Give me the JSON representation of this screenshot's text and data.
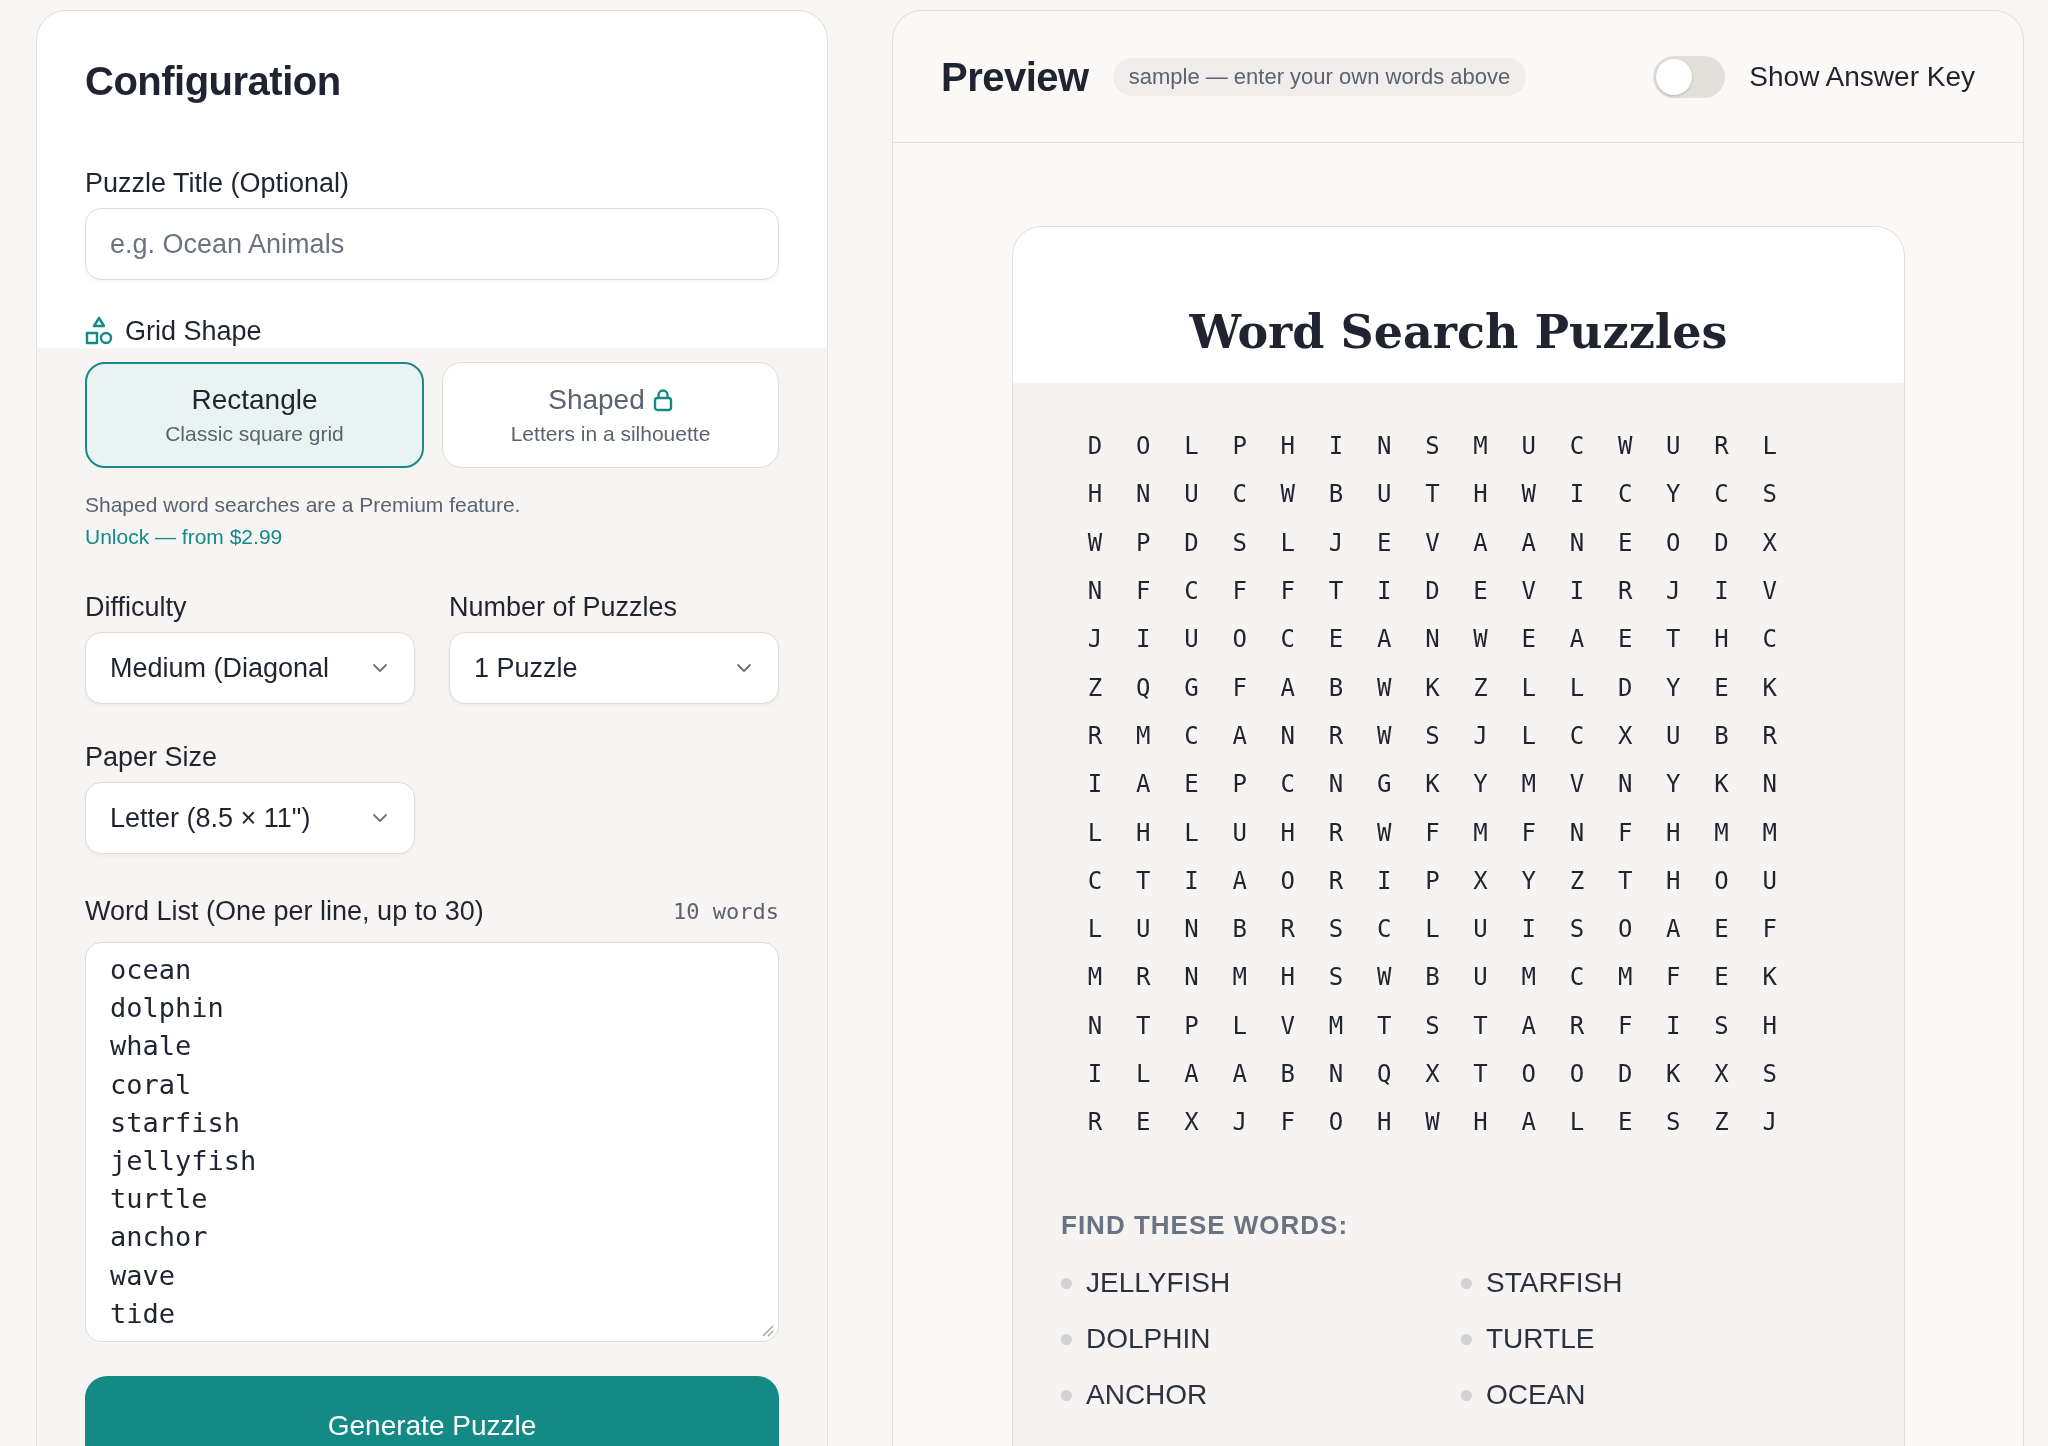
{
  "config": {
    "heading": "Configuration",
    "title_field": {
      "label": "Puzzle Title (Optional)",
      "placeholder": "e.g. Ocean Animals"
    },
    "grid_shape": {
      "label": "Grid Shape",
      "options": [
        {
          "title": "Rectangle",
          "subtitle": "Classic square grid",
          "selected": true,
          "locked": false
        },
        {
          "title": "Shaped",
          "subtitle": "Letters in a silhouette",
          "selected": false,
          "locked": true
        }
      ],
      "note": "Shaped word searches are a Premium feature.",
      "link": "Unlock — from $2.99"
    },
    "difficulty": {
      "label": "Difficulty",
      "value": "Medium (Diagonal"
    },
    "count": {
      "label": "Number of Puzzles",
      "value": "1 Puzzle"
    },
    "paper": {
      "label": "Paper Size",
      "value": "Letter (8.5 × 11\")"
    },
    "word_list": {
      "label": "Word List (One per line, up to 30)",
      "count": "10 words",
      "lines": [
        "ocean",
        "dolphin",
        "whale",
        "coral",
        "starfish",
        "jellyfish",
        "turtle",
        "anchor",
        "wave",
        "tide"
      ]
    },
    "generate_button": "Generate Puzzle"
  },
  "preview": {
    "heading": "Preview",
    "badge": "sample — enter your own words above",
    "answer_key": {
      "label": "Show Answer Key",
      "on": false
    },
    "puzzle": {
      "title": "Word Search Puzzles",
      "grid": [
        [
          "D",
          "O",
          "L",
          "P",
          "H",
          "I",
          "N",
          "S",
          "M",
          "U",
          "C",
          "W",
          "U",
          "R",
          "L"
        ],
        [
          "H",
          "N",
          "U",
          "C",
          "W",
          "B",
          "U",
          "T",
          "H",
          "W",
          "I",
          "C",
          "Y",
          "C",
          "S"
        ],
        [
          "W",
          "P",
          "D",
          "S",
          "L",
          "J",
          "E",
          "V",
          "A",
          "A",
          "N",
          "E",
          "O",
          "D",
          "X"
        ],
        [
          "N",
          "F",
          "C",
          "F",
          "F",
          "T",
          "I",
          "D",
          "E",
          "V",
          "I",
          "R",
          "J",
          "I",
          "V"
        ],
        [
          "J",
          "I",
          "U",
          "O",
          "C",
          "E",
          "A",
          "N",
          "W",
          "E",
          "A",
          "E",
          "T",
          "H",
          "C"
        ],
        [
          "Z",
          "Q",
          "G",
          "F",
          "A",
          "B",
          "W",
          "K",
          "Z",
          "L",
          "L",
          "D",
          "Y",
          "E",
          "K"
        ],
        [
          "R",
          "M",
          "C",
          "A",
          "N",
          "R",
          "W",
          "S",
          "J",
          "L",
          "C",
          "X",
          "U",
          "B",
          "R"
        ],
        [
          "I",
          "A",
          "E",
          "P",
          "C",
          "N",
          "G",
          "K",
          "Y",
          "M",
          "V",
          "N",
          "Y",
          "K",
          "N"
        ],
        [
          "L",
          "H",
          "L",
          "U",
          "H",
          "R",
          "W",
          "F",
          "M",
          "F",
          "N",
          "F",
          "H",
          "M",
          "M"
        ],
        [
          "C",
          "T",
          "I",
          "A",
          "O",
          "R",
          "I",
          "P",
          "X",
          "Y",
          "Z",
          "T",
          "H",
          "O",
          "U"
        ],
        [
          "L",
          "U",
          "N",
          "B",
          "R",
          "S",
          "C",
          "L",
          "U",
          "I",
          "S",
          "O",
          "A",
          "E",
          "F"
        ],
        [
          "M",
          "R",
          "N",
          "M",
          "H",
          "S",
          "W",
          "B",
          "U",
          "M",
          "C",
          "M",
          "F",
          "E",
          "K"
        ],
        [
          "N",
          "T",
          "P",
          "L",
          "V",
          "M",
          "T",
          "S",
          "T",
          "A",
          "R",
          "F",
          "I",
          "S",
          "H"
        ],
        [
          "I",
          "L",
          "A",
          "A",
          "B",
          "N",
          "Q",
          "X",
          "T",
          "O",
          "O",
          "D",
          "K",
          "X",
          "S"
        ],
        [
          "R",
          "E",
          "X",
          "J",
          "F",
          "O",
          "H",
          "W",
          "H",
          "A",
          "L",
          "E",
          "S",
          "Z",
          "J"
        ]
      ],
      "find_heading": "FIND THESE WORDS:",
      "words": [
        "JELLYFISH",
        "STARFISH",
        "DOLPHIN",
        "TURTLE",
        "ANCHOR",
        "OCEAN"
      ]
    }
  }
}
